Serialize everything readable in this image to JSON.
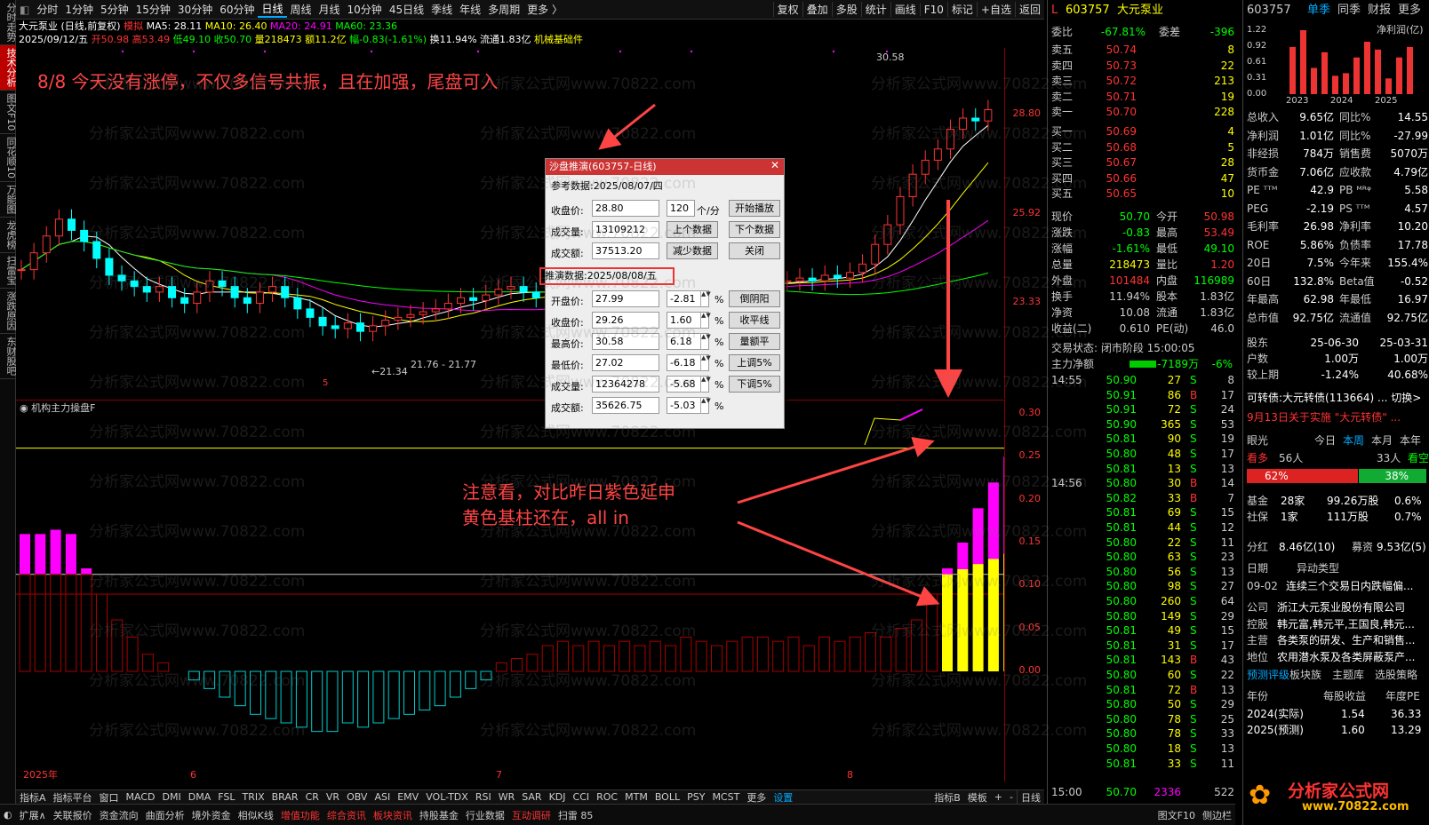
{
  "left_tabs": [
    "分时走势",
    "技术分析",
    "图文F10",
    "同花顺10",
    "万能图",
    "龙虎榜",
    "扫雷宝",
    "涨跌原因",
    "东财股吧"
  ],
  "toolbar": {
    "items": [
      "分时",
      "1分钟",
      "5分钟",
      "15分钟",
      "30分钟",
      "60分钟",
      "日线",
      "周线",
      "月线",
      "10分钟",
      "45日线",
      "季线",
      "年线",
      "多周期",
      "更多 〉"
    ],
    "active": "日线",
    "right_items": [
      "复权",
      "叠加",
      "多股",
      "统计",
      "画线",
      "F10",
      "标记",
      "+自选",
      "返回"
    ]
  },
  "infobar": {
    "stock": "大元泵业 (日线,前复权)",
    "mode": "模拟",
    "ma5": "MA5: 28.11",
    "ma10": "MA10: 26.40",
    "ma20": "MA20: 24.91",
    "ma60": "MA60: 23.36",
    "line2_date": "2025/09/12/五",
    "open": "开50.98",
    "high": "高53.49",
    "low": "低49.10",
    "close": "收50.70",
    "vol": "量218473",
    "amount": "额11.2亿",
    "change": "幅-0.83(-1.61%)",
    "turnover": "换11.94%",
    "float": "流通1.83亿",
    "industry": "机械基础件"
  },
  "annotations": {
    "top": "8/8 今天没有涨停，不仅多信号共振，且在加强，尾盘可入",
    "bottom1": "注意看，对比昨日紫色延申",
    "bottom2": "黄色基柱还在，all in"
  },
  "price_labels": [
    "28.80",
    "25.92",
    "23.33"
  ],
  "chart_labels": {
    "hi": "30.58",
    "lo": "←21.34",
    "mid": "21.76 - 21.77",
    "mark": "5"
  },
  "ind_title": "机构主力操盘F",
  "ind_labels": [
    "0.30",
    "0.25",
    "0.20",
    "0.15",
    "0.10",
    "0.05",
    "0.00"
  ],
  "x_labels": [
    "2025年",
    "6",
    "7",
    "8"
  ],
  "watermark": "分析家公式网www.70822.com",
  "dialog": {
    "title": "沙盘推演(603757-日线)",
    "ref": "参考数据:2025/08/07/四",
    "ref_close_l": "收盘价:",
    "ref_close": "28.80",
    "ref_vol_l": "成交量:",
    "ref_vol": "13109212",
    "ref_amt_l": "成交额:",
    "ref_amt": "37513.20",
    "speed": "120",
    "speed_unit": "个/分",
    "btn_play": "开始播放",
    "btn_prev": "上个数据",
    "btn_next": "下个数据",
    "btn_less": "减少数据",
    "btn_close": "关闭",
    "sim": "推演数据:2025/08/08/五",
    "rows": [
      {
        "l": "开盘价:",
        "v": "27.99",
        "p": "-2.81",
        "b": "倒阴阳"
      },
      {
        "l": "收盘价:",
        "v": "29.26",
        "p": "1.60",
        "b": "收平线"
      },
      {
        "l": "最高价:",
        "v": "30.58",
        "p": "6.18",
        "b": "量额平"
      },
      {
        "l": "最低价:",
        "v": "27.02",
        "p": "-6.18",
        "b": "上调5%"
      },
      {
        "l": "成交量:",
        "v": "12364278",
        "p": "-5.68",
        "b": "下调5%"
      },
      {
        "l": "成交额:",
        "v": "35626.75",
        "p": "-5.03",
        "b": ""
      }
    ],
    "pct": "%"
  },
  "bottom1": [
    "指标A",
    "指标平台",
    "窗口",
    "MACD",
    "DMI",
    "DMA",
    "FSL",
    "TRIX",
    "BRAR",
    "CR",
    "VR",
    "OBV",
    "ASI",
    "EMV",
    "VOL-TDX",
    "RSI",
    "WR",
    "SAR",
    "KDJ",
    "CCI",
    "ROC",
    "MTM",
    "BOLL",
    "PSY",
    "MCST",
    "更多",
    "设置"
  ],
  "bottom1_right": [
    "指标B",
    "模板",
    "+",
    "-"
  ],
  "period": "日线",
  "bottom2": [
    "扩展∧",
    "关联报价",
    "资金流向",
    "曲面分析",
    "境外资金",
    "相似K线",
    "增值功能",
    "综合资讯",
    "板块资讯",
    "持股基金",
    "行业数据",
    "互动调研",
    "扫雷 85"
  ],
  "bottom2_right": [
    "图文F10",
    "侧边栏"
  ],
  "quote": {
    "code": "603757",
    "name": "大元泵业",
    "weibi_l": "委比",
    "weibi": "-67.81%",
    "weicha_l": "委差",
    "weicha": "-396",
    "sells": [
      [
        "卖五",
        "50.74",
        "8"
      ],
      [
        "卖四",
        "50.73",
        "22"
      ],
      [
        "卖三",
        "50.72",
        "213"
      ],
      [
        "卖二",
        "50.71",
        "19"
      ],
      [
        "卖一",
        "50.70",
        "228"
      ]
    ],
    "buys": [
      [
        "买一",
        "50.69",
        "4"
      ],
      [
        "买二",
        "50.68",
        "5"
      ],
      [
        "买三",
        "50.67",
        "28"
      ],
      [
        "买四",
        "50.66",
        "47"
      ],
      [
        "买五",
        "50.65",
        "10"
      ]
    ],
    "stats": [
      [
        "现价",
        "50.70",
        "今开",
        "50.98"
      ],
      [
        "涨跌",
        "-0.83",
        "最高",
        "53.49"
      ],
      [
        "涨幅",
        "-1.61%",
        "最低",
        "49.10"
      ],
      [
        "总量",
        "218473",
        "量比",
        "1.20"
      ],
      [
        "外盘",
        "101484",
        "内盘",
        "116989"
      ],
      [
        "换手",
        "11.94%",
        "股本",
        "1.83亿"
      ],
      [
        "净资",
        "10.08",
        "流通",
        "1.83亿"
      ],
      [
        "收益(二)",
        "0.610",
        "PE(动)",
        "46.0"
      ]
    ],
    "status": "交易状态: 闭市阶段 15:00:05",
    "zl_l": "主力净额",
    "zl": "-7189万",
    "zl_p": "-6%",
    "ticks": [
      [
        "14:55",
        "50.90",
        "27",
        "S",
        "8"
      ],
      [
        "",
        "50.91",
        "86",
        "B",
        "17"
      ],
      [
        "",
        "50.91",
        "72",
        "S",
        "24"
      ],
      [
        "",
        "50.90",
        "365",
        "S",
        "53"
      ],
      [
        "",
        "50.81",
        "90",
        "S",
        "19"
      ],
      [
        "",
        "50.80",
        "48",
        "S",
        "17"
      ],
      [
        "",
        "50.81",
        "13",
        "S",
        "13"
      ],
      [
        "14:56",
        "50.80",
        "30",
        "B",
        "14"
      ],
      [
        "",
        "50.82",
        "33",
        "B",
        "7"
      ],
      [
        "",
        "50.81",
        "69",
        "S",
        "15"
      ],
      [
        "",
        "50.81",
        "44",
        "S",
        "12"
      ],
      [
        "",
        "50.80",
        "22",
        "S",
        "11"
      ],
      [
        "",
        "50.80",
        "63",
        "S",
        "23"
      ],
      [
        "",
        "50.80",
        "56",
        "S",
        "13"
      ],
      [
        "",
        "50.80",
        "98",
        "S",
        "27"
      ],
      [
        "",
        "50.80",
        "260",
        "S",
        "64"
      ],
      [
        "",
        "50.80",
        "149",
        "S",
        "29"
      ],
      [
        "",
        "50.81",
        "49",
        "S",
        "15"
      ],
      [
        "",
        "50.81",
        "31",
        "S",
        "17"
      ],
      [
        "",
        "50.81",
        "143",
        "B",
        "43"
      ],
      [
        "",
        "50.80",
        "60",
        "S",
        "22"
      ],
      [
        "",
        "50.81",
        "72",
        "B",
        "13"
      ],
      [
        "",
        "50.80",
        "50",
        "S",
        "29"
      ],
      [
        "",
        "50.80",
        "78",
        "S",
        "25"
      ],
      [
        "",
        "50.80",
        "78",
        "S",
        "33"
      ],
      [
        "",
        "50.80",
        "18",
        "S",
        "13"
      ],
      [
        "",
        "50.81",
        "33",
        "S",
        "11"
      ]
    ],
    "close_time": "15:00",
    "close_px": "50.70",
    "close_v": "2336",
    "close_n": "522"
  },
  "f10": {
    "code": "603757",
    "tabs": [
      "单季",
      "同季",
      "财报",
      "更多"
    ],
    "chart_title": "净利润(亿)",
    "years": [
      "2023",
      "2024",
      "2025"
    ],
    "yaxis": [
      "1.22",
      "0.92",
      "0.61",
      "0.31",
      "0.00"
    ],
    "bars": [
      0.9,
      1.22,
      0.5,
      0.8,
      0.35,
      0.4,
      0.7,
      1.0,
      0.85,
      0.3,
      0.7,
      0.9
    ],
    "rows": [
      [
        "总收入",
        "9.65亿",
        "同比%",
        "14.55"
      ],
      [
        "净利润",
        "1.01亿",
        "同比%",
        "-27.99"
      ],
      [
        "非经损",
        "784万",
        "销售费",
        "5070万"
      ],
      [
        "货币金",
        "7.06亿",
        "应收款",
        "4.79亿"
      ],
      [
        "PE ᵀᵀᴹ",
        "42.9",
        "PB ᴹᴿᵠ",
        "5.58"
      ],
      [
        "PEG",
        "-2.19",
        "PS ᵀᵀᴹ",
        "4.57"
      ],
      [
        "毛利率",
        "26.98",
        "净利率",
        "10.20"
      ],
      [
        "ROE",
        "5.86%",
        "负债率",
        "17.78"
      ],
      [
        "20日",
        "7.5%",
        "今年来",
        "155.4%"
      ],
      [
        "60日",
        "132.8%",
        "Beta值",
        "-0.52"
      ],
      [
        "年最高",
        "62.98",
        "年最低",
        "16.97"
      ],
      [
        "总市值",
        "92.75亿",
        "流通值",
        "92.75亿"
      ]
    ],
    "holder": {
      "l": "股东",
      "d1": "25-06-30",
      "d2": "25-03-31",
      "hu_l": "户数",
      "h1": "1.00万",
      "h2": "1.00万",
      "cmp_l": "较上期",
      "c1": "-1.24%",
      "c2": "40.68%"
    },
    "conv": "可转债:大元转债(113664) ... 切换>",
    "notice": "9月13日关于实施 \"大元转债\" ...",
    "eye": {
      "l": "眼光",
      "t1": "今日",
      "t2": "本周",
      "t3": "本月",
      "t4": "本年",
      "bull_l": "看多",
      "bull": "56人",
      "bear": "33人",
      "bear_l": "看空",
      "bp": "62%",
      "sp": "38%"
    },
    "fund": [
      [
        "基金",
        "28家",
        "99.26万股",
        "0.6%"
      ],
      [
        "社保",
        "1家",
        "111万股",
        "0.7%"
      ]
    ],
    "div": [
      "分红",
      "8.46亿(10)",
      "募资",
      "9.53亿(5)"
    ],
    "event": {
      "h1": "日期",
      "h2": "异动类型",
      "d": "09-02",
      "t": "连续三个交易日内跌幅偏..."
    },
    "company": [
      [
        "公司",
        "浙江大元泵业股份有限公司"
      ],
      [
        "控股",
        "韩元富,韩元平,王国良,韩元..."
      ],
      [
        "主营",
        "各类泵的研发、生产和销售..."
      ],
      [
        "地位",
        "农用潜水泵及各类屏蔽泵产..."
      ]
    ],
    "links": [
      "预测评级",
      "板块族",
      "主题库",
      "选股策略"
    ],
    "forecast_h": [
      "年份",
      "每股收益",
      "年度PE"
    ],
    "forecast": [
      [
        "2024(实际)",
        "1.54",
        "36.33"
      ],
      [
        "2025(预测)",
        "1.60",
        "13.29"
      ]
    ],
    "logo": "分析家公式网",
    "logo_url": "www.70822.com"
  }
}
